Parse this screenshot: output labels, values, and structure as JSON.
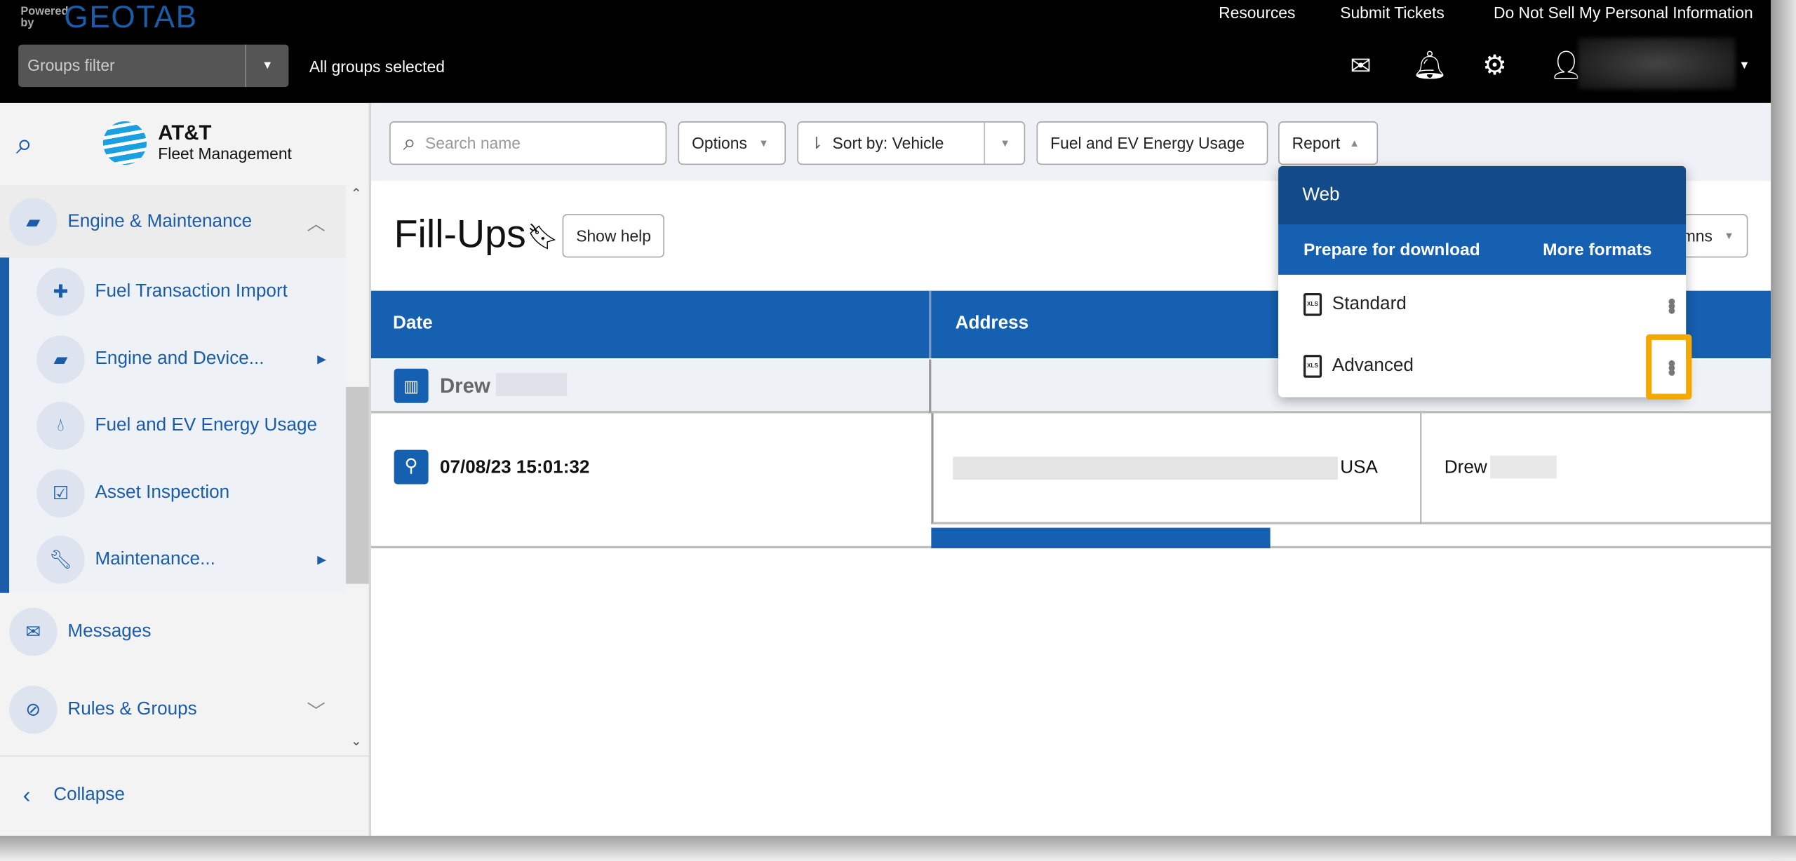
{
  "header": {
    "powered_by": "Powered by",
    "brand": "GEOTAB",
    "links": [
      "Resources",
      "Submit Tickets",
      "Do Not Sell My Personal Information"
    ],
    "groups_filter_placeholder": "Groups filter",
    "groups_status": "All groups selected",
    "icons": [
      "mail-icon",
      "bell-icon",
      "gear-icon",
      "user-icon"
    ]
  },
  "sidebar": {
    "logo_line1": "AT&T",
    "logo_line2": "Fleet Management",
    "section": "Engine & Maintenance",
    "sub_items": [
      {
        "label": "Fuel Transaction Import",
        "icon": "puzzle-icon"
      },
      {
        "label": "Engine and Device...",
        "icon": "engine-icon",
        "has_submenu": true
      },
      {
        "label": "Fuel and EV Energy Usage",
        "icon": "fuel-drop-icon"
      },
      {
        "label": "Asset Inspection",
        "icon": "clipboard-check-icon"
      },
      {
        "label": "Maintenance...",
        "icon": "wrench-icon",
        "has_submenu": true
      }
    ],
    "items": [
      {
        "label": "Messages",
        "icon": "envelope-icon"
      },
      {
        "label": "Rules & Groups",
        "icon": "rules-icon"
      }
    ],
    "collapse": "Collapse"
  },
  "toolbar": {
    "search_placeholder": "Search name",
    "options": "Options",
    "sort_prefix": "Sort by:",
    "sort_value": "Vehicle",
    "fuel_usage": "Fuel and EV Energy Usage",
    "report": "Report"
  },
  "page": {
    "title": "Fill-Ups",
    "show_help": "Show help",
    "columns_partial": "mns"
  },
  "table": {
    "columns": [
      "Date",
      "Address"
    ],
    "group_label": "Drew",
    "rows": [
      {
        "date": "07/08/23 15:01:32",
        "address_suffix": "USA",
        "driver": "Drew"
      }
    ]
  },
  "report_menu": {
    "web": "Web",
    "prepare": "Prepare for download",
    "more_formats": "More formats",
    "items": [
      {
        "label": "Standard",
        "icon": "xls-file-icon",
        "badge": "XLS"
      },
      {
        "label": "Advanced",
        "icon": "xls-file-icon",
        "badge": "XLS"
      }
    ],
    "highlight_color": "#f5a800"
  },
  "colors": {
    "primary": "#1560b0",
    "menu_dark": "#124a8a",
    "topbar": "#000000"
  }
}
